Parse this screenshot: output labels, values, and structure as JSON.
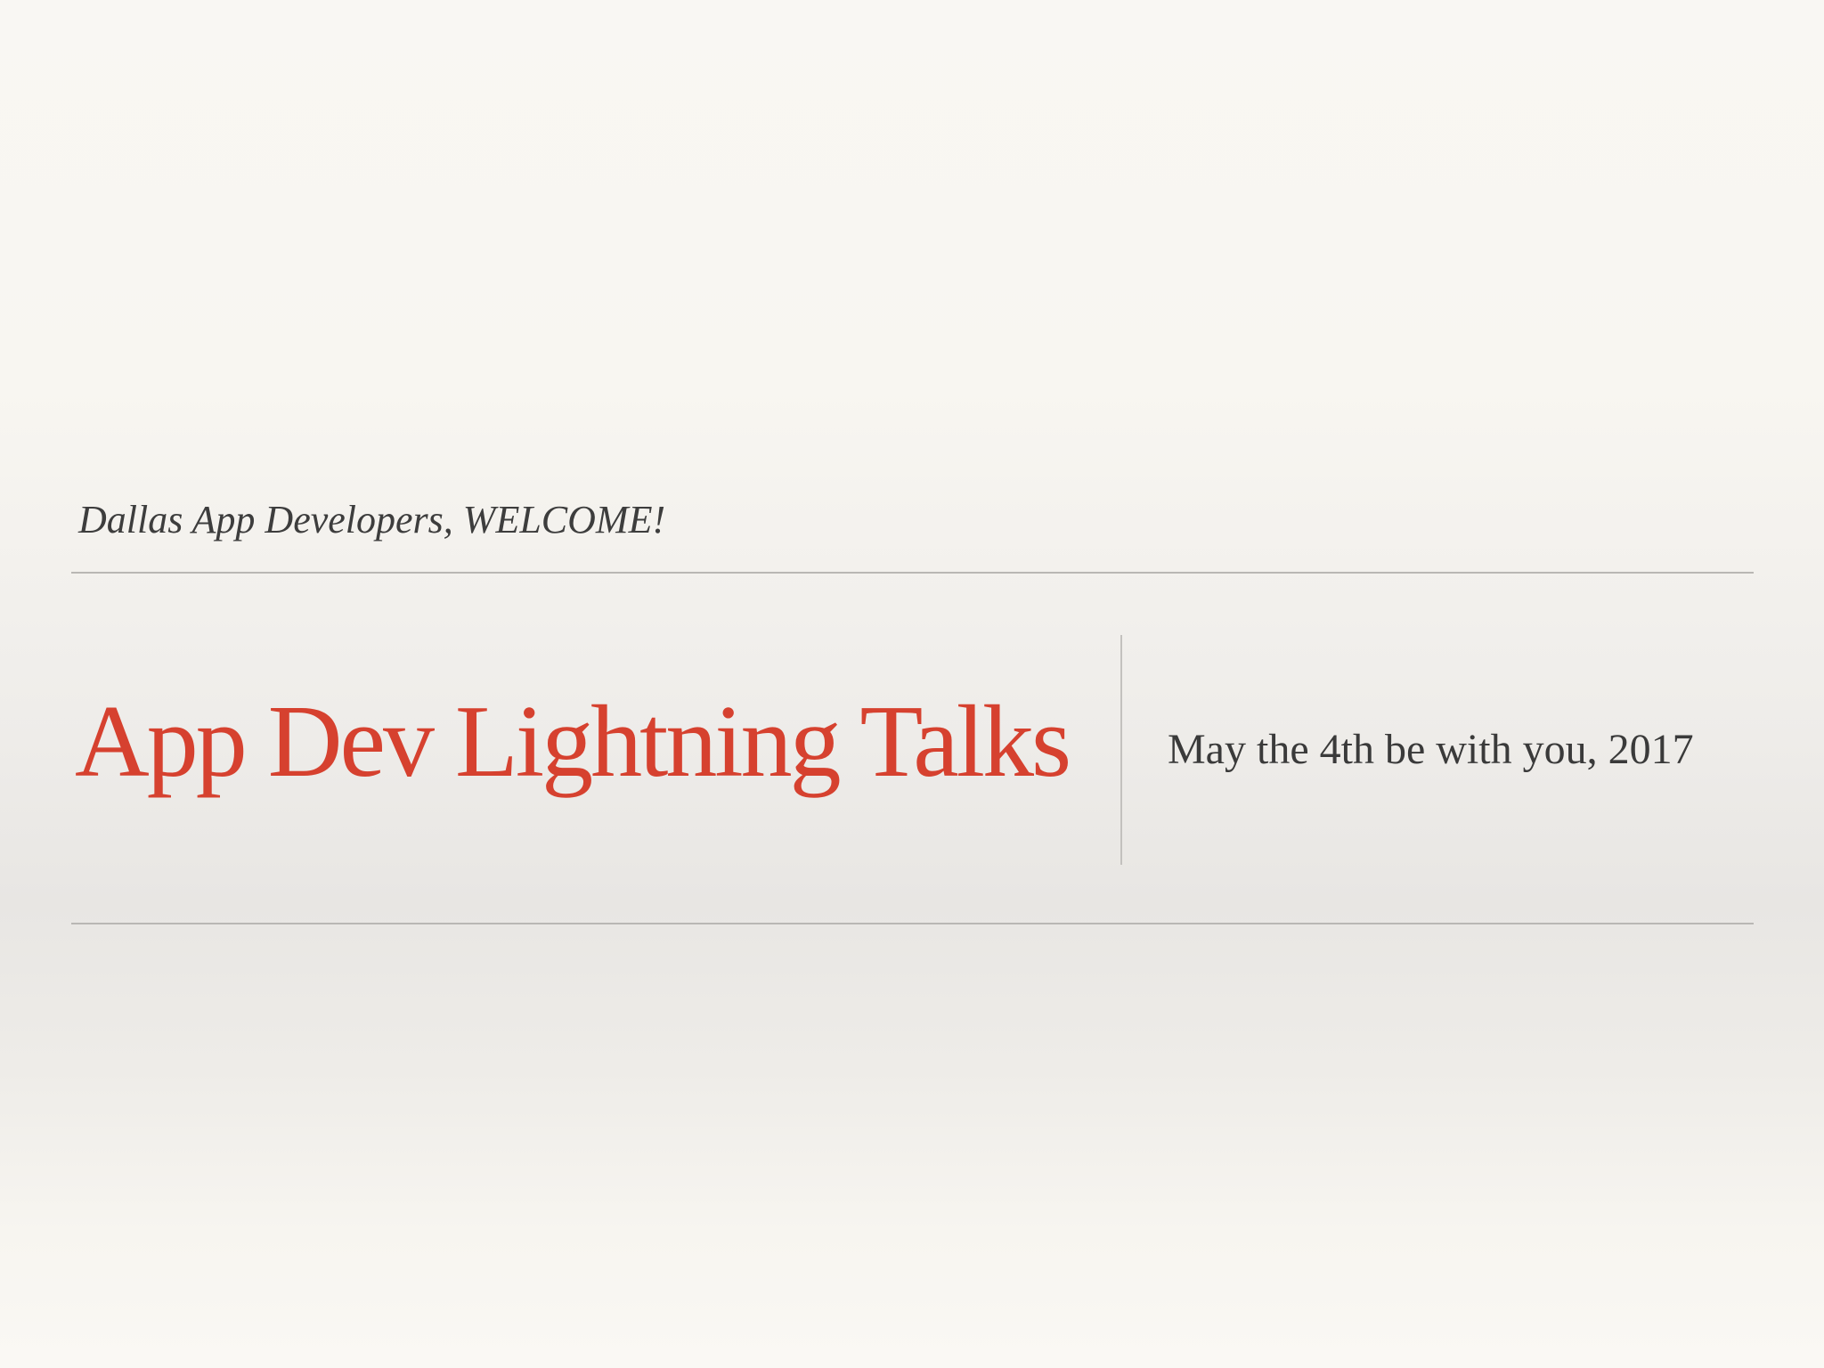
{
  "slide": {
    "subtitle": "Dallas App Developers, WELCOME!",
    "title": "App Dev Lightning Talks",
    "date": "May the 4th be with you, 2017"
  },
  "colors": {
    "title": "#d6412f",
    "text": "#3d3d3d",
    "rule": "#b9b7b4",
    "background": "#f8f6f1"
  }
}
